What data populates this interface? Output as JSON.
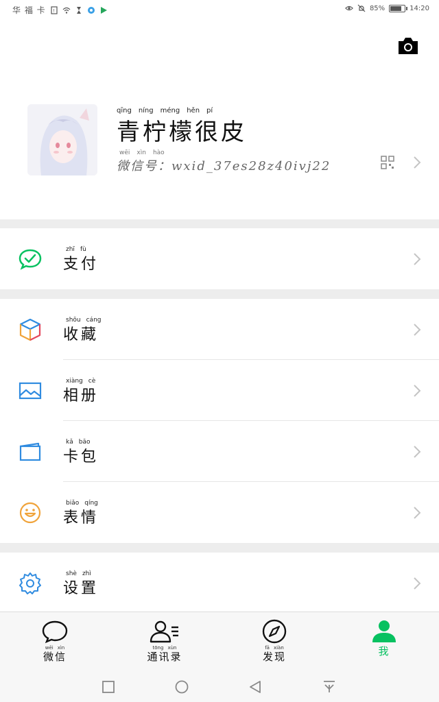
{
  "status": {
    "left_text": "华 福 卡",
    "battery": "85%",
    "battery_level": 0.85,
    "time": "14:20"
  },
  "profile": {
    "nickname_pinyin": [
      "qīng",
      "níng",
      "méng",
      "hěn",
      "pí"
    ],
    "nickname": "青柠檬很皮",
    "wechat_id_pinyin": [
      "wēi",
      "xìn",
      "hào"
    ],
    "wechat_id_label": "微信号",
    "wechat_id_value": "：wxid_37es28z40ivj22"
  },
  "menu": {
    "pay": {
      "pinyin": [
        "zhī",
        "fù"
      ],
      "label": "支付",
      "icon": "wechat-pay-icon"
    },
    "favorites": {
      "pinyin": [
        "shōu",
        "cáng"
      ],
      "label": "收藏",
      "icon": "cube-icon"
    },
    "album": {
      "pinyin": [
        "xiàng",
        "cè"
      ],
      "label": "相册",
      "icon": "image-icon"
    },
    "cards": {
      "pinyin": [
        "kǎ",
        "bāo"
      ],
      "label": "卡包",
      "icon": "wallet-icon"
    },
    "stickers": {
      "pinyin": [
        "biǎo",
        "qíng"
      ],
      "label": "表情",
      "icon": "smiley-icon"
    },
    "settings": {
      "pinyin": [
        "shè",
        "zhì"
      ],
      "label": "设置",
      "icon": "gear-icon"
    }
  },
  "tabs": [
    {
      "pinyin": [
        "wēi",
        "xìn"
      ],
      "label": "微信",
      "icon": "chat-bubble-icon"
    },
    {
      "pinyin": [
        "tōng",
        "xùn"
      ],
      "label": "通讯录",
      "icon": "contacts-icon"
    },
    {
      "pinyin": [
        "fā",
        "xiàn"
      ],
      "label": "发现",
      "icon": "compass-icon"
    },
    {
      "pinyin": [],
      "label": "我",
      "icon": "person-icon",
      "active": true
    }
  ],
  "colors": {
    "accent_green": "#07c160",
    "pay_green": "#07c160",
    "cube_blue": "#2f8be0",
    "album_blue": "#2f8be0",
    "wallet_blue": "#2f8be0",
    "smiley_orange": "#f0a33a",
    "gear_blue": "#2f8be0",
    "band_gray": "#ededed"
  }
}
